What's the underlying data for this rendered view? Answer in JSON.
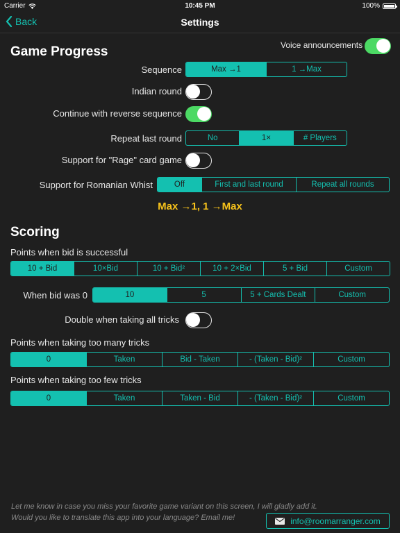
{
  "status": {
    "carrier": "Carrier",
    "time": "10:45 PM",
    "battery": "100%"
  },
  "nav": {
    "back": "Back",
    "title": "Settings"
  },
  "voice": {
    "label": "Voice announcements",
    "on": true
  },
  "game_progress": {
    "title": "Game Progress",
    "sequence": {
      "label": "Sequence",
      "options": [
        "Max →1",
        "1 →Max"
      ],
      "selected": 0
    },
    "indian_round": {
      "label": "Indian round",
      "on": false
    },
    "reverse": {
      "label": "Continue with reverse sequence",
      "on": true
    },
    "repeat_last": {
      "label": "Repeat last round",
      "options": [
        "No",
        "1×",
        "# Players"
      ],
      "selected": 1
    },
    "rage": {
      "label": "Support for \"Rage\" card game",
      "on": false
    },
    "romanian": {
      "label": "Support for Romanian Whist",
      "options": [
        "Off",
        "First and last round",
        "Repeat all rounds"
      ],
      "selected": 0
    },
    "summary": "Max →1, 1 →Max"
  },
  "scoring": {
    "title": "Scoring",
    "success": {
      "label": "Points when bid is successful",
      "options": [
        "10 + Bid",
        "10×Bid",
        "10 + Bid²",
        "10 + 2×Bid",
        "5 + Bid",
        "Custom"
      ],
      "selected": 0
    },
    "bid_zero": {
      "label": "When bid was 0",
      "options": [
        "10",
        "5",
        "5 + Cards Dealt",
        "Custom"
      ],
      "selected": 0
    },
    "double_all": {
      "label": "Double when taking all tricks",
      "on": false
    },
    "too_many": {
      "label": "Points when taking too many tricks",
      "options": [
        "0",
        "Taken",
        "Bid - Taken",
        "- (Taken - Bid)²",
        "Custom"
      ],
      "selected": 0
    },
    "too_few": {
      "label": "Points when taking too few tricks",
      "options": [
        "0",
        "Taken",
        "Taken - Bid",
        "- (Taken - Bid)²",
        "Custom"
      ],
      "selected": 0
    }
  },
  "footer": {
    "line1": "Let me know in case you miss your favorite game variant on this screen, I will gladly add it.",
    "line2": "Would you like to translate this app into your language? Email me!",
    "email": "info@roomarranger.com"
  },
  "colors": {
    "accent": "#14c0b0",
    "toggle_on": "#4cd964",
    "highlight": "#f7c21b",
    "background": "#1f1f1f"
  }
}
